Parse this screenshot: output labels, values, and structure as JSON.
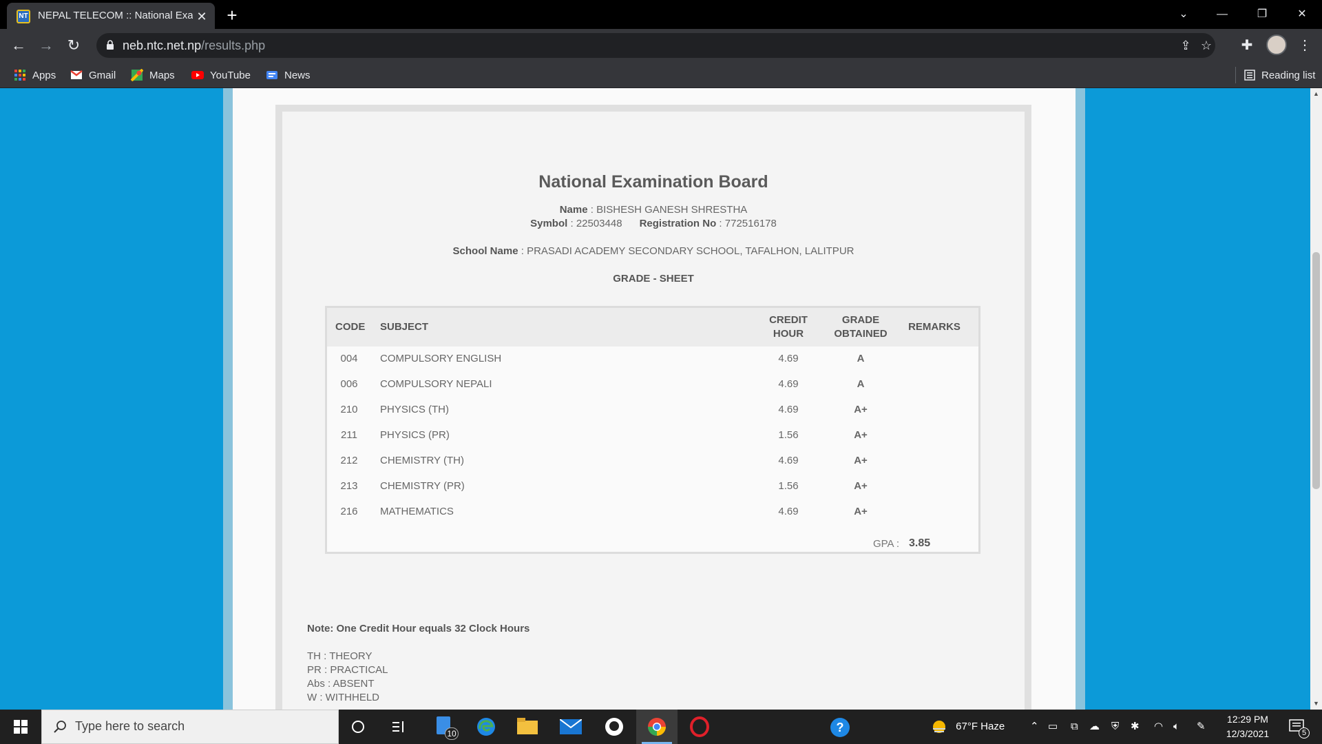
{
  "browser": {
    "tab_title": "NEPAL TELECOM :: National Exam",
    "favicon_text": "NT",
    "url_domain": "neb.ntc.net.np",
    "url_path": "/results.php",
    "bookmarks": [
      {
        "label": "Apps",
        "icon": "apps-grid-icon"
      },
      {
        "label": "Gmail",
        "icon": "gmail-icon"
      },
      {
        "label": "Maps",
        "icon": "maps-icon"
      },
      {
        "label": "YouTube",
        "icon": "youtube-icon"
      },
      {
        "label": "News",
        "icon": "news-icon"
      }
    ],
    "reading_list": "Reading list"
  },
  "result": {
    "board": "National Examination Board",
    "name_label": "Name",
    "name": "BISHESH GANESH SHRESTHA",
    "symbol_label": "Symbol",
    "symbol": "22503448",
    "reg_label": "Registration No",
    "reg": "772516178",
    "school_label": "School Name",
    "school": "PRASADI ACADEMY SECONDARY SCHOOL, TAFALHON, LALITPUR",
    "sheet_title": "GRADE - SHEET",
    "headers": {
      "code": "CODE",
      "subject": "SUBJECT",
      "credit1": "CREDIT",
      "credit2": "HOUR",
      "grade1": "GRADE",
      "grade2": "OBTAINED",
      "remarks": "REMARKS"
    },
    "rows": [
      {
        "code": "004",
        "subject": "COMPULSORY ENGLISH",
        "credit": "4.69",
        "grade": "A",
        "remarks": ""
      },
      {
        "code": "006",
        "subject": "COMPULSORY NEPALI",
        "credit": "4.69",
        "grade": "A",
        "remarks": ""
      },
      {
        "code": "210",
        "subject": "PHYSICS (TH)",
        "credit": "4.69",
        "grade": "A+",
        "remarks": ""
      },
      {
        "code": "211",
        "subject": "PHYSICS (PR)",
        "credit": "1.56",
        "grade": "A+",
        "remarks": ""
      },
      {
        "code": "212",
        "subject": "CHEMISTRY (TH)",
        "credit": "4.69",
        "grade": "A+",
        "remarks": ""
      },
      {
        "code": "213",
        "subject": "CHEMISTRY (PR)",
        "credit": "1.56",
        "grade": "A+",
        "remarks": ""
      },
      {
        "code": "216",
        "subject": "MATHEMATICS",
        "credit": "4.69",
        "grade": "A+",
        "remarks": ""
      }
    ],
    "gpa_label": "GPA :",
    "gpa": "3.85",
    "note": "Note: One Credit Hour equals 32 Clock Hours",
    "abbreviations": [
      "TH : THEORY",
      "PR : PRACTICAL",
      "Abs : ABSENT",
      "W : WITHHELD"
    ]
  },
  "taskbar": {
    "search_placeholder": "Type here to search",
    "file_badge": "10",
    "weather": "67°F  Haze",
    "time": "12:29 PM",
    "date": "12/3/2021",
    "notification_count": "5"
  },
  "colors": {
    "page_background": "#0c9ad8",
    "browser_frame": "#35363a",
    "taskbar": "#202020"
  }
}
